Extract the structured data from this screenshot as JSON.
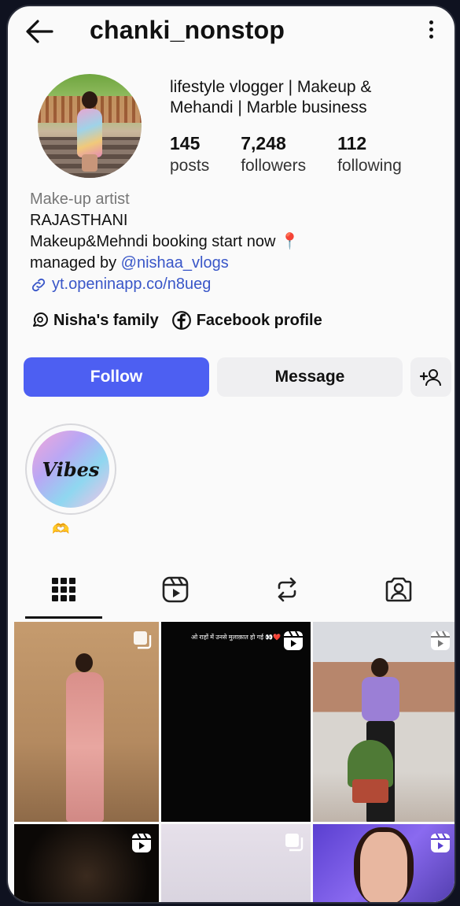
{
  "header": {
    "username": "chanki_nonstop"
  },
  "profile": {
    "headline_line1": "lifestyle vlogger | Makeup &",
    "headline_line2": "Mehandi | Marble business",
    "stats": [
      {
        "number": "145",
        "label": "posts"
      },
      {
        "number": "7,248",
        "label": "followers"
      },
      {
        "number": "112",
        "label": "following"
      }
    ],
    "category": "Make-up artist",
    "bio_line1": "RAJASTHANI",
    "bio_line2": "Makeup&Mehndi booking start now 📍",
    "managed_by_prefix": "managed by ",
    "managed_by_handle": "@nishaa_vlogs",
    "link": "yt.openinapp.co/n8ueg"
  },
  "chips": [
    {
      "label": "Nisha's family",
      "icon": "threads-icon"
    },
    {
      "label": "Facebook profile",
      "icon": "facebook-icon"
    }
  ],
  "actions": {
    "follow": "Follow",
    "message": "Message",
    "add_user_icon": "add-user-icon"
  },
  "highlights": [
    {
      "cover_text": "Vibes",
      "label": "🫶"
    }
  ],
  "tabs": [
    "grid-icon",
    "reels-icon",
    "reposts-icon",
    "tagged-icon"
  ],
  "posts": [
    {
      "badge": "carousel-icon"
    },
    {
      "badge": "reel-icon",
      "caption": "ओ राहों में उनसे मुलाक़ात हो गई 👀❤️"
    },
    {
      "badge": "reel-icon"
    },
    {
      "badge": "reel-icon"
    },
    {
      "badge": "carousel-icon"
    },
    {
      "badge": "reel-icon"
    }
  ]
}
